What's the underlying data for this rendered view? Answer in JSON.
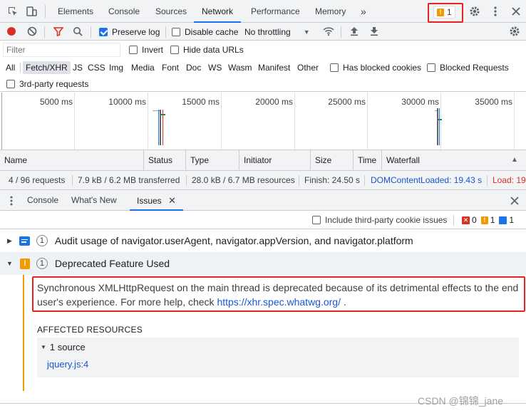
{
  "top_tabs": [
    "Elements",
    "Console",
    "Sources",
    "Network",
    "Performance",
    "Memory"
  ],
  "more_tabs": "»",
  "issue_badge_count": "1",
  "toolbar": {
    "preserve_log": "Preserve log",
    "disable_cache": "Disable cache",
    "throttling": "No throttling"
  },
  "filter": {
    "placeholder": "Filter",
    "invert": "Invert",
    "hide_data_urls": "Hide data URLs",
    "types": [
      "All",
      "Fetch/XHR",
      "JS",
      "CSS",
      "Img",
      "Media",
      "Font",
      "Doc",
      "WS",
      "Wasm",
      "Manifest",
      "Other"
    ],
    "blocked_cookies": "Has blocked cookies",
    "blocked_requests": "Blocked Requests",
    "third_party": "3rd-party requests"
  },
  "overview_ticks": [
    "5000 ms",
    "10000 ms",
    "15000 ms",
    "20000 ms",
    "25000 ms",
    "30000 ms",
    "35000 ms"
  ],
  "columns": [
    "Name",
    "Status",
    "Type",
    "Initiator",
    "Size",
    "Time",
    "Waterfall"
  ],
  "summary": {
    "requests": "4 / 96 requests",
    "transferred": "7.9 kB / 6.2 MB transferred",
    "resources": "28.0 kB / 6.7 MB resources",
    "finish": "Finish: 24.50 s",
    "dcl": "DOMContentLoaded: 19.43 s",
    "load": "Load: 19"
  },
  "drawer_tabs": [
    "Console",
    "What's New",
    "Issues"
  ],
  "issues_bar": {
    "include_third_party": "Include third-party cookie issues",
    "err_count": "0",
    "warn_count": "1",
    "info_count": "1"
  },
  "issues": [
    {
      "count": "1",
      "title": "Audit usage of navigator.userAgent, navigator.appVersion, and navigator.platform"
    },
    {
      "count": "1",
      "title": "Deprecated Feature Used"
    }
  ],
  "issue_detail": {
    "text_line1": "Synchronous XMLHttpRequest on the main thread is deprecated because of its detrimental effects to the end",
    "text_line2": "user's experience. For more help, check ",
    "link": "https://xhr.spec.whatwg.org/",
    "after_link": " .",
    "affected": "AFFECTED RESOURCES",
    "source_count": "1 source",
    "resource": "jquery.js:4"
  },
  "watermark": "CSDN @锦锦_jane",
  "colors": {
    "accent": "#1a73e8",
    "warning": "#f29900",
    "error": "#d93025",
    "highlight": "#e8221f"
  }
}
